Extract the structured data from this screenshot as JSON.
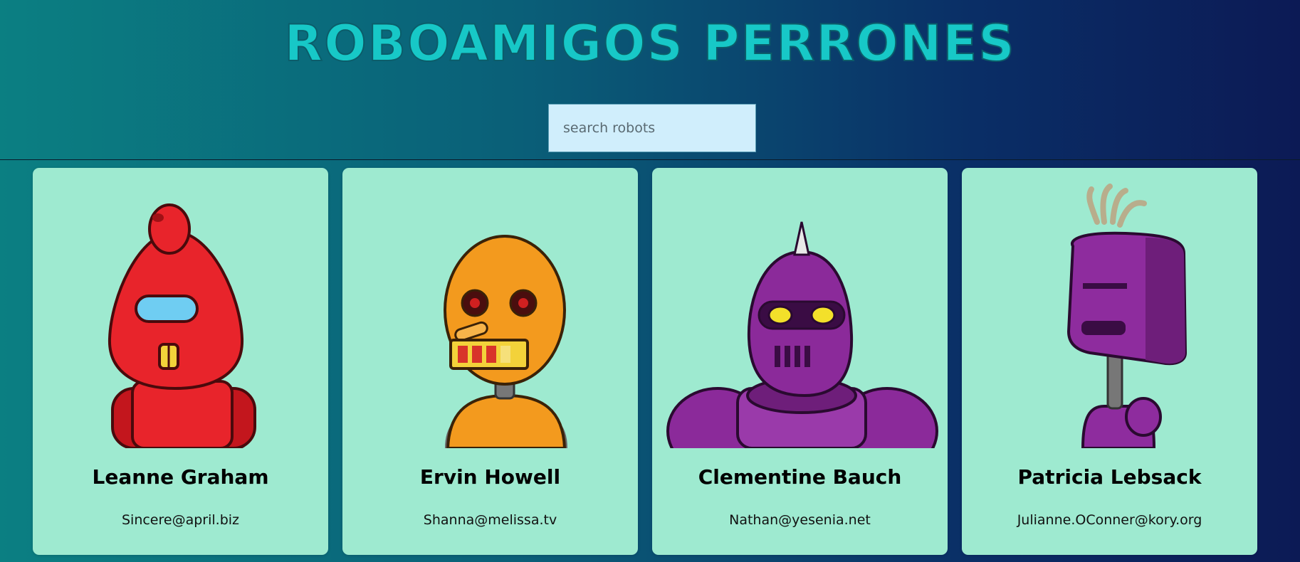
{
  "header": {
    "title": "ROBOAMIGOS PERRONES"
  },
  "search": {
    "placeholder": "search robots",
    "value": ""
  },
  "robots": [
    {
      "name": "Leanne Graham",
      "email": "Sincere@april.biz",
      "color": "#e8242b",
      "icon": "red-robot-avatar"
    },
    {
      "name": "Ervin Howell",
      "email": "Shanna@melissa.tv",
      "color": "#f39a1e",
      "icon": "orange-robot-avatar"
    },
    {
      "name": "Clementine Bauch",
      "email": "Nathan@yesenia.net",
      "color": "#8b2a9a",
      "icon": "purple-robot-avatar"
    },
    {
      "name": "Patricia Lebsack",
      "email": "Julianne.OConner@kory.org",
      "color": "#8e2c9e",
      "icon": "purple-robot-avatar"
    }
  ],
  "colors": {
    "card_background": "#9eead0",
    "title_color": "#17c8c7",
    "search_background": "#d0eefc"
  }
}
